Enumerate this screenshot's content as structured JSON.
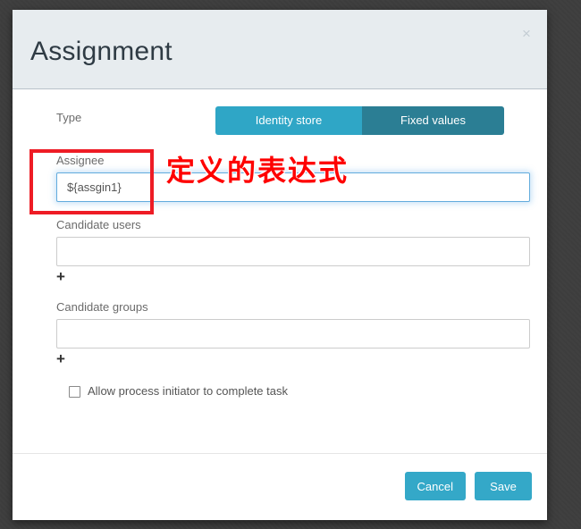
{
  "backdrop": {
    "color": "#3e3e3e"
  },
  "modal": {
    "title": "Assignment",
    "close_label": "×",
    "type_row": {
      "label": "Type",
      "tabs": [
        {
          "label": "Identity store",
          "active": false,
          "color": "#2fa6c6"
        },
        {
          "label": "Fixed values",
          "active": true,
          "color": "#2b7e94"
        }
      ]
    },
    "fields": [
      {
        "label": "Assignee",
        "value": "${assgin1}",
        "placeholder": "",
        "focused": true,
        "has_add": false
      },
      {
        "label": "Candidate users",
        "value": "",
        "placeholder": "",
        "focused": false,
        "has_add": true,
        "add_label": "+"
      },
      {
        "label": "Candidate groups",
        "value": "",
        "placeholder": "",
        "focused": false,
        "has_add": true,
        "add_label": "+"
      }
    ],
    "checkbox": {
      "label": "Allow process initiator to complete task",
      "checked": false
    },
    "footer": {
      "cancel_label": "Cancel",
      "save_label": "Save",
      "button_color": "#34a8c8"
    }
  },
  "annotations": {
    "highlight_color": "#ee1c25",
    "text": "定义的表达式",
    "text_color": "#fe0000"
  }
}
